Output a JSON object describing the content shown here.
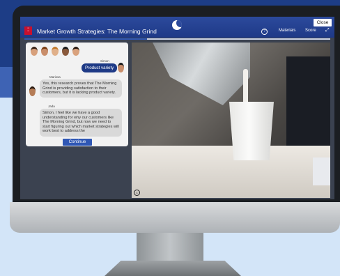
{
  "header": {
    "title": "Market Growth Strategies: The Morning Grind",
    "close_label": "Close",
    "materials_label": "Materials",
    "score_label": "Score",
    "progress": 0.4
  },
  "chat": {
    "user_name": "Simon",
    "user_message": "Product variety",
    "messages": [
      {
        "speaker": "Marissa",
        "text": "Yes, this research proves that The Morning Grind is providing satisfaction to their customers, but it is lacking product variety."
      },
      {
        "speaker": "Jada",
        "text": "Simon, I feel like we have a good understanding for why our customers like The Morning Grind, but now we need to start figuring out which market strategies will work best to address the"
      }
    ],
    "continue_label": "Continue"
  },
  "icons": {
    "help": "help-icon",
    "expand": "expand-icon",
    "captions": "captions-icon"
  },
  "colors": {
    "header": "#1e3987",
    "accent": "#2f57b5",
    "user_bubble": "#1e3a86"
  }
}
